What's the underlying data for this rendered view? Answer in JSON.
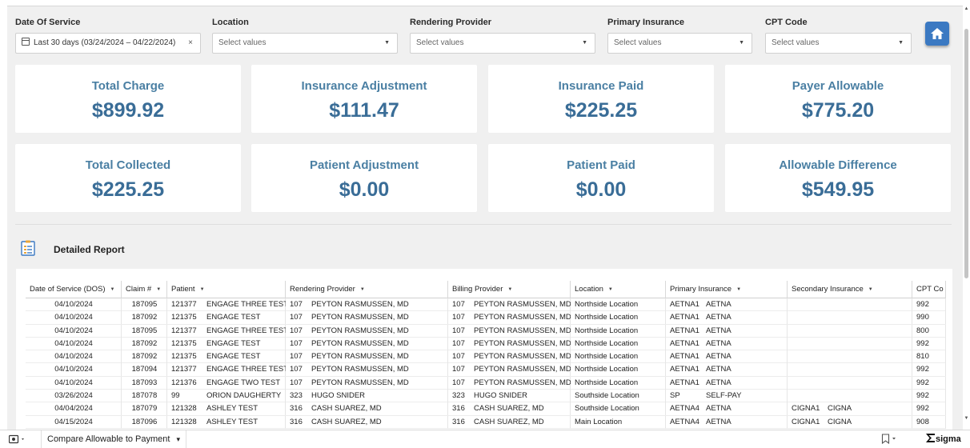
{
  "filters": {
    "date_of_service": {
      "label": "Date Of Service",
      "value": "Last 30 days (03/24/2024 – 04/22/2024)",
      "clear": "×"
    },
    "location": {
      "label": "Location",
      "placeholder": "Select values"
    },
    "rendering_provider": {
      "label": "Rendering Provider",
      "placeholder": "Select values"
    },
    "primary_insurance": {
      "label": "Primary Insurance",
      "placeholder": "Select values"
    },
    "cpt_code": {
      "label": "CPT Code",
      "placeholder": "Select values"
    },
    "caret": "▼"
  },
  "home_button": {
    "icon": "home-icon"
  },
  "kpis": [
    {
      "label": "Total Charge",
      "value": "$899.92"
    },
    {
      "label": "Insurance Adjustment",
      "value": "$111.47"
    },
    {
      "label": "Insurance Paid",
      "value": "$225.25"
    },
    {
      "label": "Payer Allowable",
      "value": "$775.20"
    },
    {
      "label": "Total Collected",
      "value": "$225.25"
    },
    {
      "label": "Patient Adjustment",
      "value": "$0.00"
    },
    {
      "label": "Patient Paid",
      "value": "$0.00"
    },
    {
      "label": "Allowable Difference",
      "value": "$549.95"
    }
  ],
  "report": {
    "title": "Detailed Report",
    "icon": "report-icon",
    "sort_glyph": "▼",
    "columns": [
      "Date of Service (DOS)",
      "Claim #",
      "Patient",
      "Rendering Provider",
      "Billing Provider",
      "Location",
      "Primary Insurance",
      "Secondary Insurance",
      "CPT Co"
    ],
    "rows": [
      [
        "04/10/2024",
        "187095",
        "121377",
        "ENGAGE THREE TEST",
        "107",
        "PEYTON RASMUSSEN, MD",
        "107",
        "PEYTON RASMUSSEN, MD",
        "Northside Location",
        "AETNA1",
        "AETNA",
        "",
        "",
        "992"
      ],
      [
        "04/10/2024",
        "187092",
        "121375",
        "ENGAGE TEST",
        "107",
        "PEYTON RASMUSSEN, MD",
        "107",
        "PEYTON RASMUSSEN, MD",
        "Northside Location",
        "AETNA1",
        "AETNA",
        "",
        "",
        "990"
      ],
      [
        "04/10/2024",
        "187095",
        "121377",
        "ENGAGE THREE TEST",
        "107",
        "PEYTON RASMUSSEN, MD",
        "107",
        "PEYTON RASMUSSEN, MD",
        "Northside Location",
        "AETNA1",
        "AETNA",
        "",
        "",
        "800"
      ],
      [
        "04/10/2024",
        "187092",
        "121375",
        "ENGAGE TEST",
        "107",
        "PEYTON RASMUSSEN, MD",
        "107",
        "PEYTON RASMUSSEN, MD",
        "Northside Location",
        "AETNA1",
        "AETNA",
        "",
        "",
        "992"
      ],
      [
        "04/10/2024",
        "187092",
        "121375",
        "ENGAGE TEST",
        "107",
        "PEYTON RASMUSSEN, MD",
        "107",
        "PEYTON RASMUSSEN, MD",
        "Northside Location",
        "AETNA1",
        "AETNA",
        "",
        "",
        "810"
      ],
      [
        "04/10/2024",
        "187094",
        "121377",
        "ENGAGE THREE TEST",
        "107",
        "PEYTON RASMUSSEN, MD",
        "107",
        "PEYTON RASMUSSEN, MD",
        "Northside Location",
        "AETNA1",
        "AETNA",
        "",
        "",
        "992"
      ],
      [
        "04/10/2024",
        "187093",
        "121376",
        "ENGAGE TWO TEST",
        "107",
        "PEYTON RASMUSSEN, MD",
        "107",
        "PEYTON RASMUSSEN, MD",
        "Northside Location",
        "AETNA1",
        "AETNA",
        "",
        "",
        "992"
      ],
      [
        "03/26/2024",
        "187078",
        "99",
        "ORION DAUGHERTY",
        "323",
        "HUGO SNIDER",
        "323",
        "HUGO SNIDER",
        "Southside Location",
        "SP",
        "SELF-PAY",
        "",
        "",
        "992"
      ],
      [
        "04/04/2024",
        "187079",
        "121328",
        "ASHLEY TEST",
        "316",
        "CASH SUAREZ, MD",
        "316",
        "CASH SUAREZ, MD",
        "Southside Location",
        "AETNA4",
        "AETNA",
        "CIGNA1",
        "CIGNA",
        "992"
      ],
      [
        "04/15/2024",
        "187096",
        "121328",
        "ASHLEY TEST",
        "316",
        "CASH SUAREZ, MD",
        "316",
        "CASH SUAREZ, MD",
        "Main Location",
        "AETNA4",
        "AETNA",
        "CIGNA1",
        "CIGNA",
        "908"
      ]
    ]
  },
  "bottom_bar": {
    "page_name": "Compare Allowable to Payment",
    "page_caret": "▾",
    "logo": "sigma"
  }
}
